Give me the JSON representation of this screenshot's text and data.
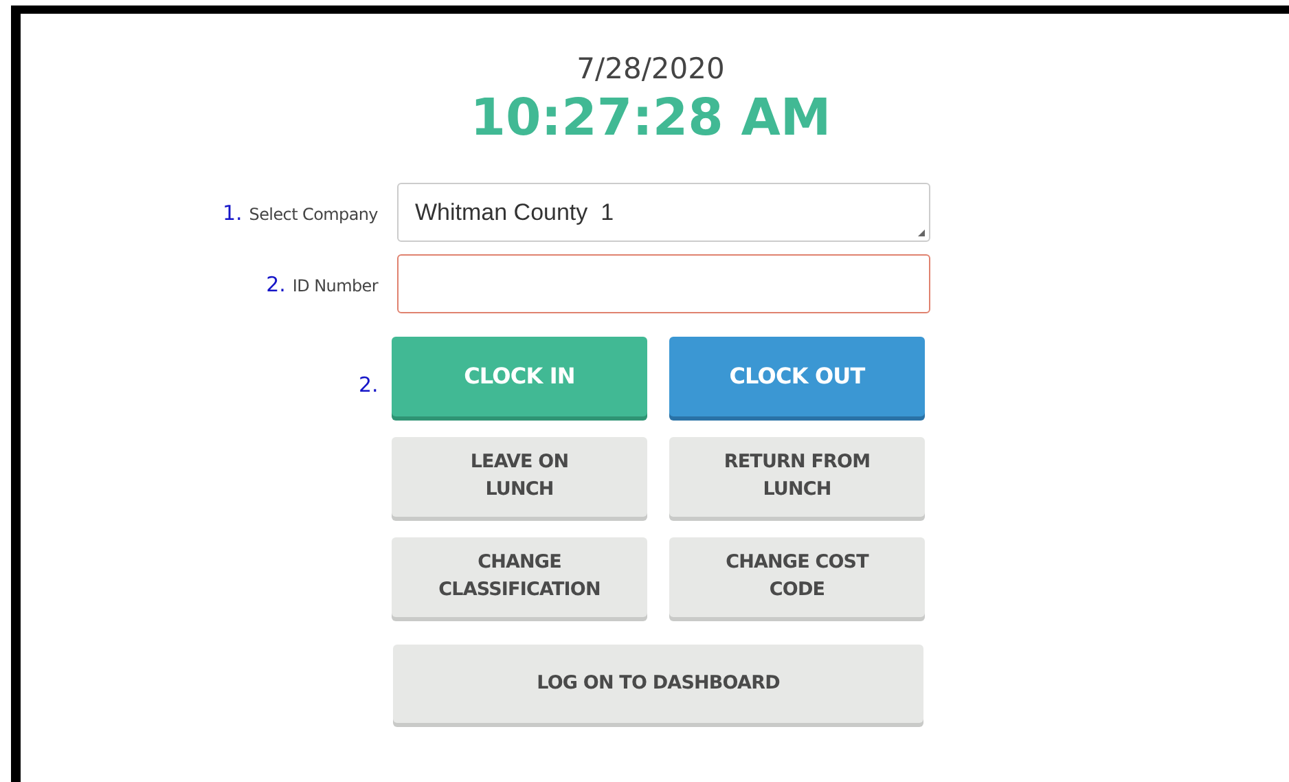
{
  "date": "7/28/2020",
  "time": "10:27:28 AM",
  "fields": [
    {
      "step": "1.",
      "label": "Select Company",
      "value": "Whitman County  1",
      "kind": "select",
      "invalid": false
    },
    {
      "step": "2.",
      "label": "ID Number",
      "kind": "text",
      "invalid": true
    }
  ],
  "clock_step": "2.",
  "buttons": [
    {
      "label": "CLOCK IN",
      "kind": "success"
    },
    {
      "label": "CLOCK OUT",
      "kind": "primary"
    },
    {
      "label": "LEAVE ON\nLUNCH",
      "kind": "default"
    },
    {
      "label": "RETURN FROM\nLUNCH",
      "kind": "default"
    },
    {
      "label": "CHANGE\nCLASSIFICATION",
      "kind": "default"
    },
    {
      "label": "CHANGE COST\nCODE",
      "kind": "default"
    }
  ],
  "dashboard_button": "LOG ON TO DASHBOARD"
}
